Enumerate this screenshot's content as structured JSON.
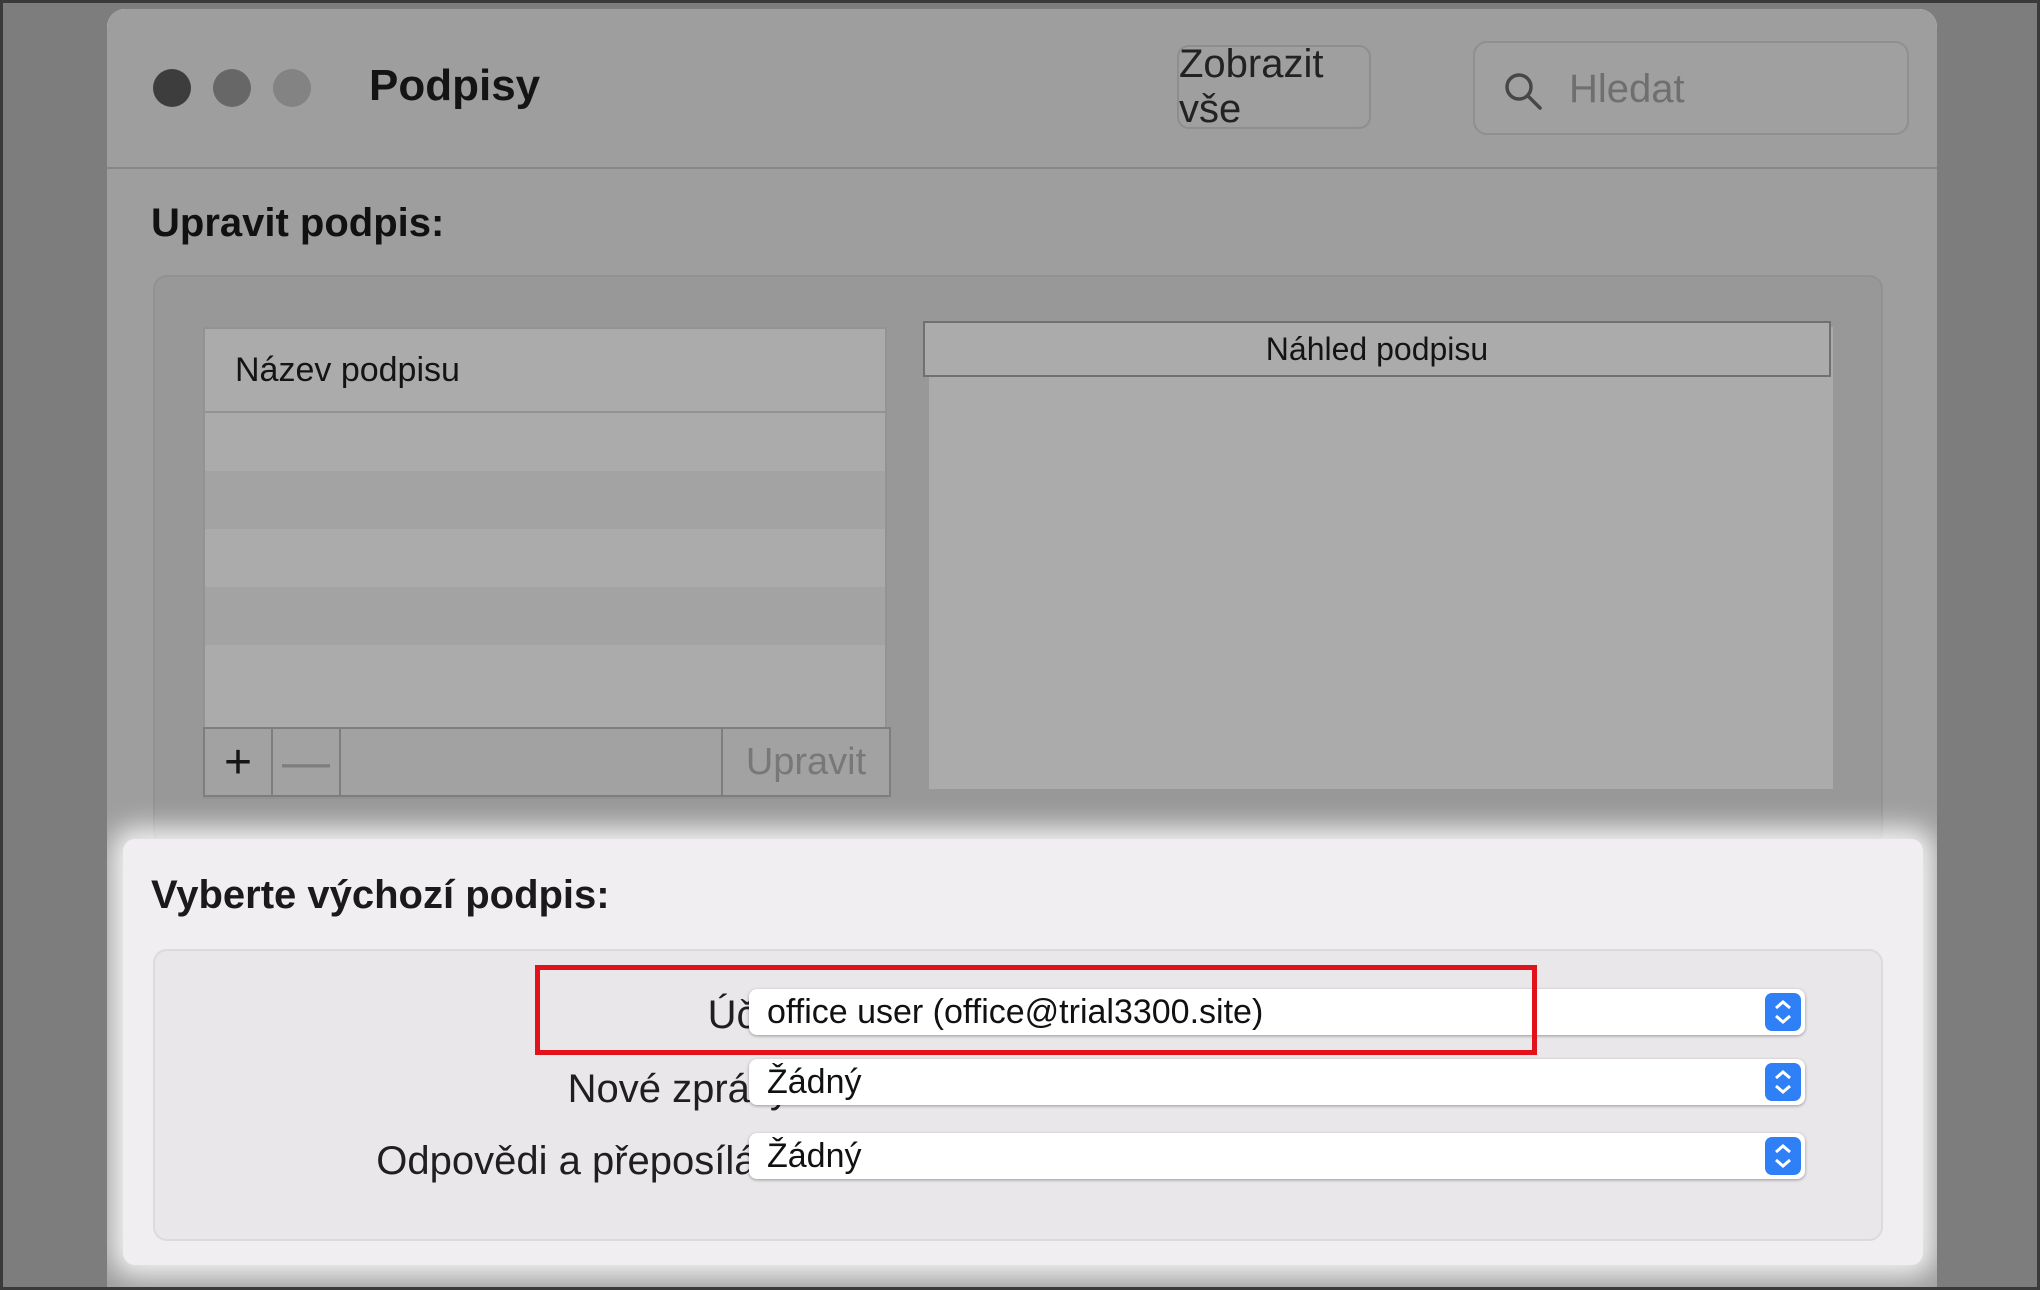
{
  "window": {
    "title": "Podpisy",
    "show_all_label": "Zobrazit vše",
    "search_placeholder": "Hledat"
  },
  "edit_section": {
    "title": "Upravit podpis:",
    "names_header": "Název podpisu",
    "preview_header": "Náhled podpisu",
    "add_label": "+",
    "remove_label": "—",
    "edit_label": "Upravit"
  },
  "default_section": {
    "title": "Vyberte výchozí podpis:",
    "fields": [
      {
        "label": "Účet:",
        "value": "office user (office@trial3300.site)"
      },
      {
        "label": "Nové zprávy:",
        "value": "Žádný"
      },
      {
        "label": "Odpovědi a přeposílání:",
        "value": "Žádný"
      }
    ]
  },
  "colors": {
    "highlight_box": "#e1121a",
    "popup_accent": "#2f7ff6"
  }
}
